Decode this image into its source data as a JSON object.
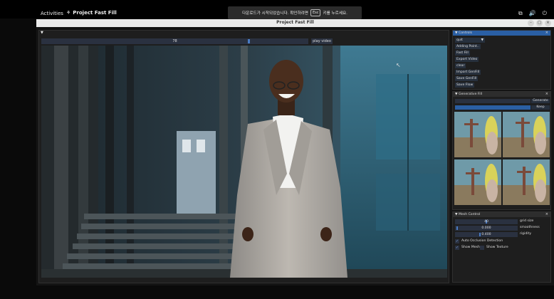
{
  "desktop": {
    "activities": "Activities",
    "app_name": "Project Fast Fill",
    "tray": [
      "⧉",
      "🔊",
      "⏻"
    ]
  },
  "toast": {
    "before": "다운로드가 시작되었습니다. 확인하려면",
    "key": "Esc",
    "after": "키를 누르세요."
  },
  "window": {
    "title": "Project Fast Fill",
    "buttons": [
      "–",
      "□",
      "×"
    ]
  },
  "video_panel": {
    "frame_value": "78",
    "frame_fraction": 0.78,
    "play_label": "play video"
  },
  "controls": {
    "title": "Controls",
    "mode_selected": "quit",
    "buttons": [
      "Adding Point..",
      "Fast Fill",
      "Export Video",
      "clear",
      "Import GenFill",
      "Save GenFill",
      "Save Flow"
    ]
  },
  "generative_fill": {
    "title": "Generative Fill",
    "generate_label": "Generate",
    "keep_label": "Keep"
  },
  "mesh_control": {
    "title": "Mesh Control",
    "sliders": [
      {
        "value": "40",
        "label": "grid size",
        "fraction": 0.5
      },
      {
        "value": "0.000",
        "label": "smoothness",
        "fraction": 0.02
      },
      {
        "value": "0.400",
        "label": "rigidity",
        "fraction": 0.4
      }
    ],
    "auto_occlusion": "Auto Occlusion Detection",
    "show_mesh": "Show Mesh",
    "show_texture": "Show Texture"
  },
  "colors": {
    "accent": "#2a5fa4",
    "panel_bg": "#1e1e1e"
  }
}
